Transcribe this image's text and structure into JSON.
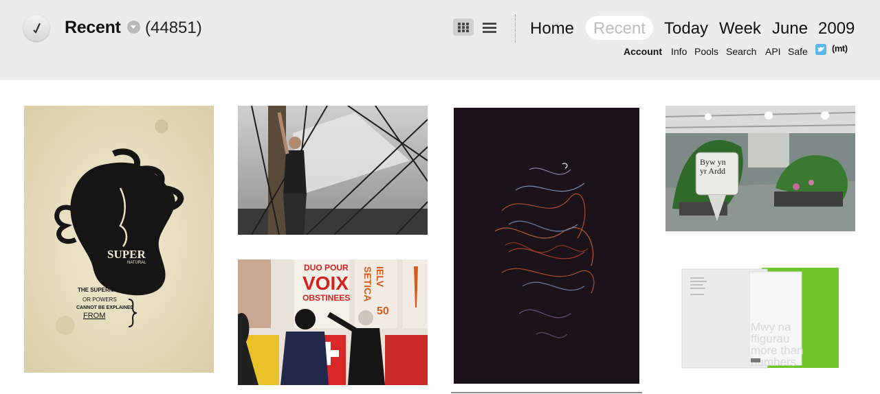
{
  "header": {
    "logo_icon": "tick-logo-icon",
    "title": "Recent",
    "count": "(44851)",
    "view_icons": [
      "grid-view-icon",
      "list-view-icon"
    ],
    "nav": {
      "home": "Home",
      "recent": "Recent",
      "today": "Today",
      "week": "Week",
      "june": "June",
      "year": "2009"
    },
    "subnav": {
      "account": "Account",
      "info": "Info",
      "pools": "Pools",
      "search": "Search",
      "api": "API",
      "safe": "Safe",
      "mt": "(mt)"
    }
  },
  "photos": [
    {
      "name": "supernatural-poster",
      "headline": "SUPER",
      "sub": "NATURAL",
      "body": [
        "THE SUPERNATURAL",
        "OR POWERS",
        "CANNOT BE EXPLAINED",
        "FROM"
      ]
    },
    {
      "name": "sailing-ship-rigging"
    },
    {
      "name": "dark-light-trails"
    },
    {
      "name": "garden-centre-sign",
      "sign_text": [
        "Byw yn",
        "yr Ardd"
      ]
    },
    {
      "name": "poster-gallery",
      "texts": [
        "DUO POUR",
        "VOIX",
        "OBSTINEES",
        "IELV",
        "SETICA",
        "50"
      ]
    },
    {
      "name": "green-brochure",
      "text": [
        "Mwy na",
        "ffigurau",
        "more than",
        "numbers"
      ]
    }
  ]
}
